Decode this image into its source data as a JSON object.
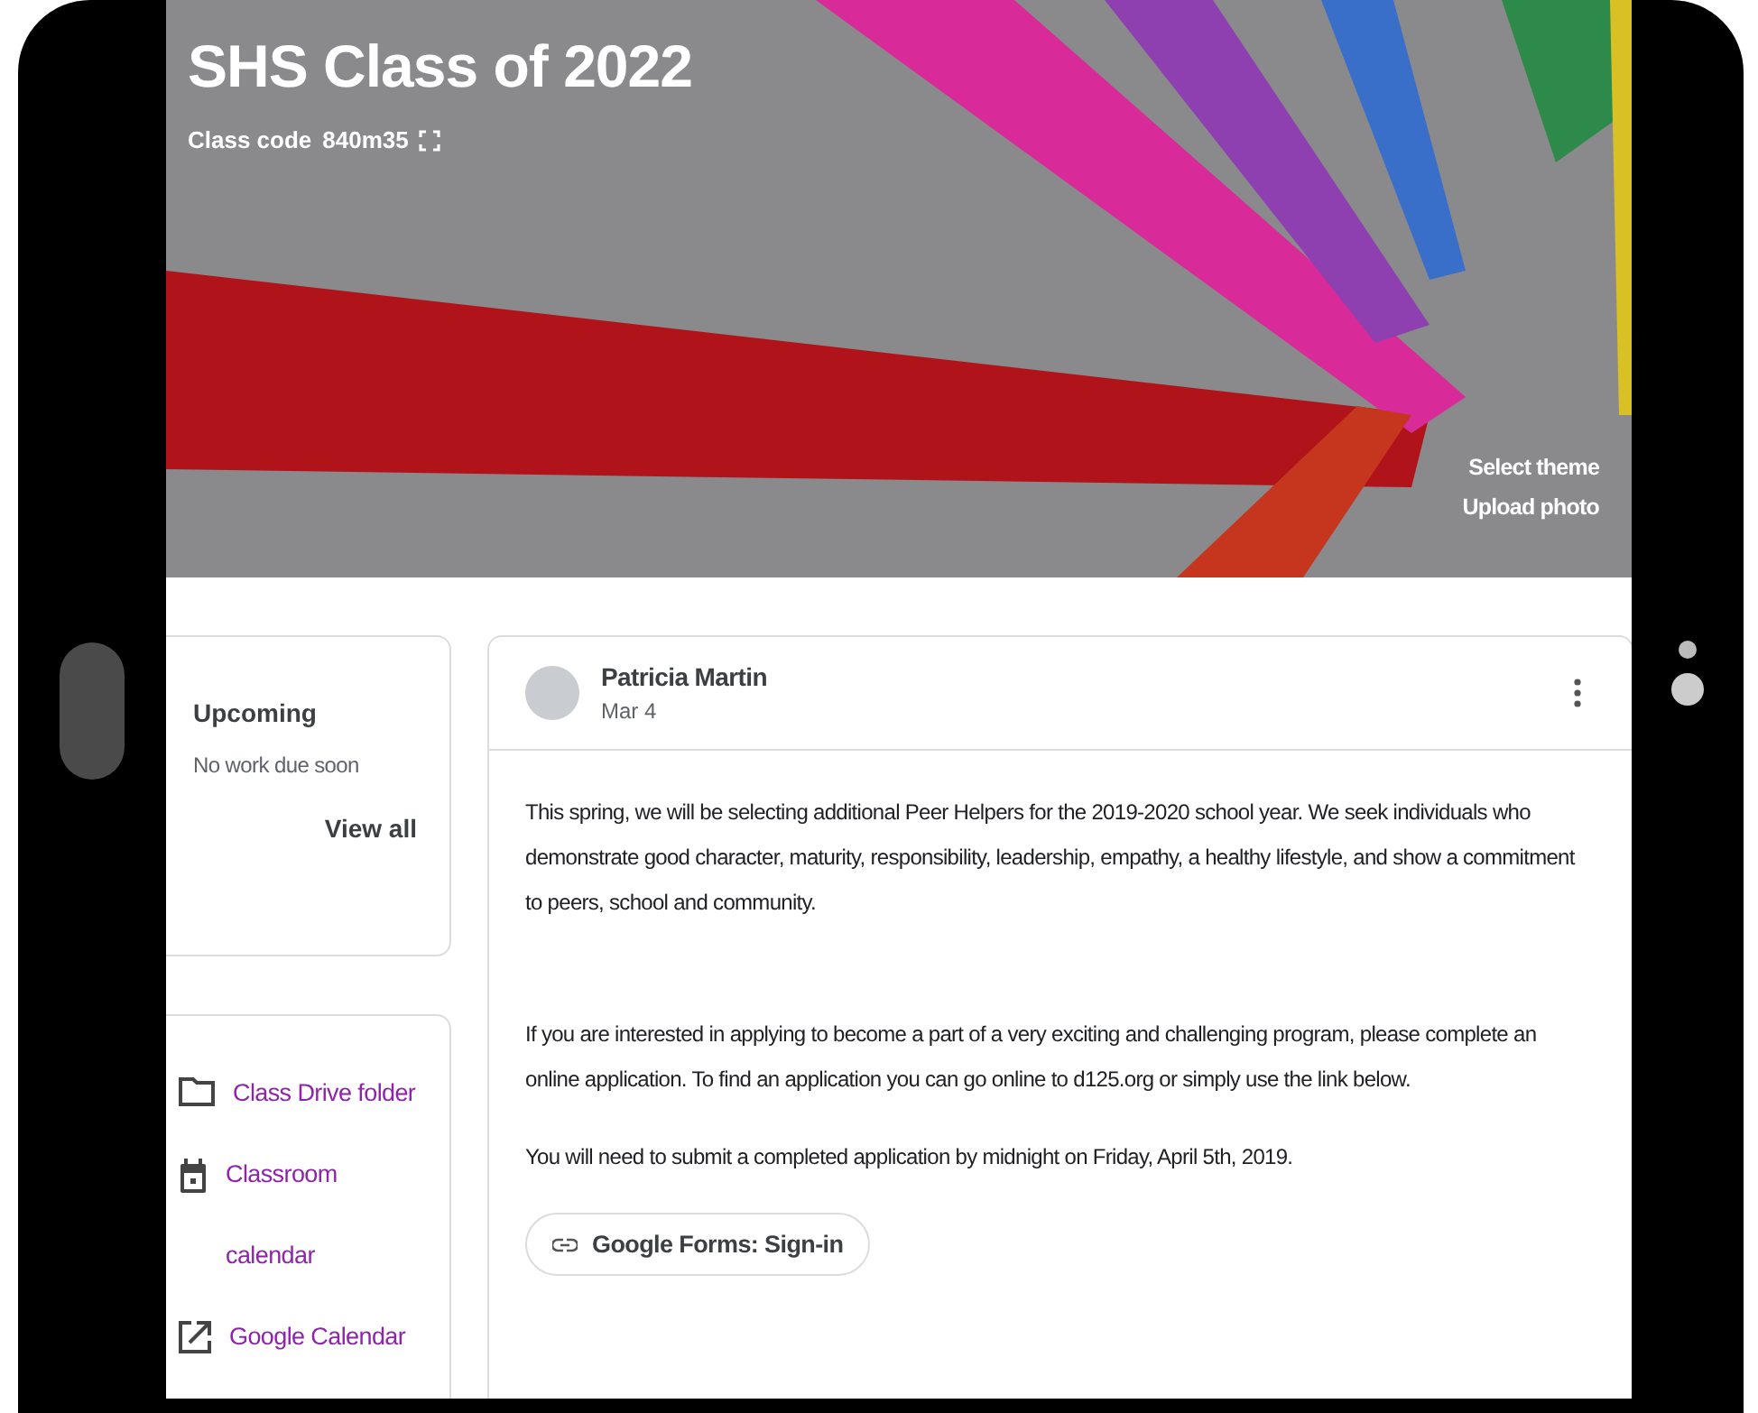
{
  "class": {
    "title": "SHS Class of 2022",
    "code_label": "Class code",
    "code": "840m35"
  },
  "banner_actions": [
    "Select theme",
    "Upload photo"
  ],
  "upcoming": {
    "title": "Upcoming",
    "message": "No work due soon",
    "link": "View all"
  },
  "links": [
    {
      "kind": "folder",
      "label": "Class Drive folder"
    },
    {
      "kind": "calendar",
      "label": "Classroom calendar"
    },
    {
      "kind": "external",
      "label": "Google Calendar"
    }
  ],
  "post": {
    "author": "Patricia Martin",
    "date": "Mar 4",
    "paragraphs": [
      "This spring, we will be selecting additional Peer Helpers for the 2019-2020 school year. We seek individuals who demonstrate good character, maturity, responsibility, leadership, empathy, a healthy lifestyle, and show a commitment to peers, school and community.",
      "If you are interested in applying to become a part of a very exciting and challenging program, please complete an online application. To find an application you can go online to d125.org or simply use the link below.",
      "You will need to submit a completed application by midnight on Friday, April 5th, 2019."
    ],
    "attachment": "Google Forms: Sign-in"
  }
}
